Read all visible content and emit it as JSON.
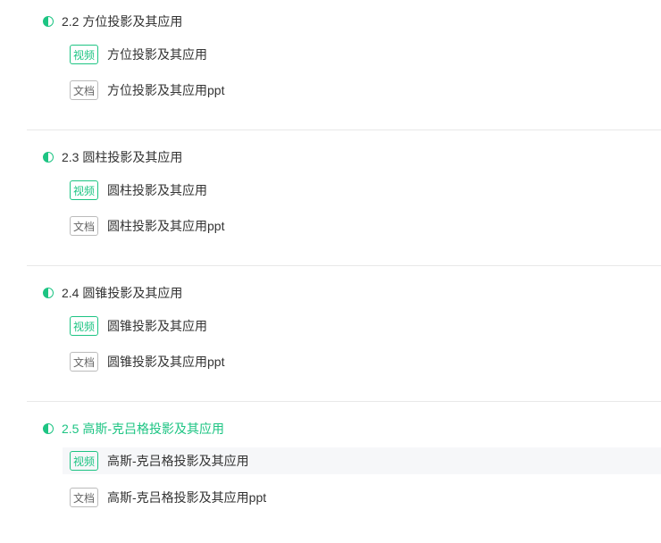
{
  "sections": [
    {
      "title": "2.2 方位投影及其应用",
      "items": [
        {
          "tag": "视频",
          "label": "方位投影及其应用"
        },
        {
          "tag": "文档",
          "label": "方位投影及其应用ppt"
        }
      ]
    },
    {
      "title": "2.3 圆柱投影及其应用",
      "items": [
        {
          "tag": "视频",
          "label": "圆柱投影及其应用"
        },
        {
          "tag": "文档",
          "label": "圆柱投影及其应用ppt"
        }
      ]
    },
    {
      "title": "2.4 圆锥投影及其应用",
      "items": [
        {
          "tag": "视频",
          "label": "圆锥投影及其应用"
        },
        {
          "tag": "文档",
          "label": "圆锥投影及其应用ppt"
        }
      ]
    },
    {
      "title": "2.5 高斯-克吕格投影及其应用",
      "items": [
        {
          "tag": "视频",
          "label": "高斯-克吕格投影及其应用"
        },
        {
          "tag": "文档",
          "label": "高斯-克吕格投影及其应用ppt"
        }
      ]
    }
  ],
  "colors": {
    "accent": "#1dc483"
  }
}
